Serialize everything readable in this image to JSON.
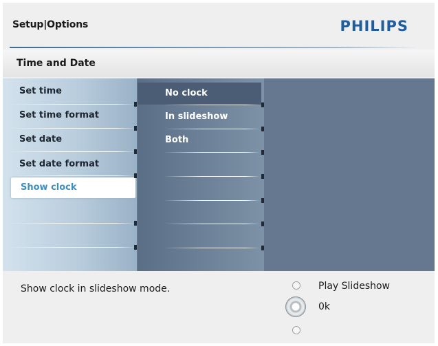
{
  "header": {
    "title": "Setup|Options",
    "brand": "PHILIPS"
  },
  "section": {
    "title": "Time and Date"
  },
  "left_menu": {
    "items": [
      {
        "label": "Set time"
      },
      {
        "label": "Set time format"
      },
      {
        "label": "Set date"
      },
      {
        "label": "Set date format"
      },
      {
        "label": "Show clock",
        "selected": true
      }
    ]
  },
  "options_menu": {
    "items": [
      {
        "label": "No clock",
        "highlighted": true
      },
      {
        "label": "In slideshow"
      },
      {
        "label": "Both"
      }
    ]
  },
  "footer": {
    "help_text": "Show clock in slideshow mode.",
    "actions": {
      "play_slideshow": "Play Slideshow",
      "ok": "0k"
    }
  },
  "colors": {
    "brand": "#1f5d9e",
    "selected_text": "#3d8fc1",
    "panel": "#6a7d94"
  }
}
